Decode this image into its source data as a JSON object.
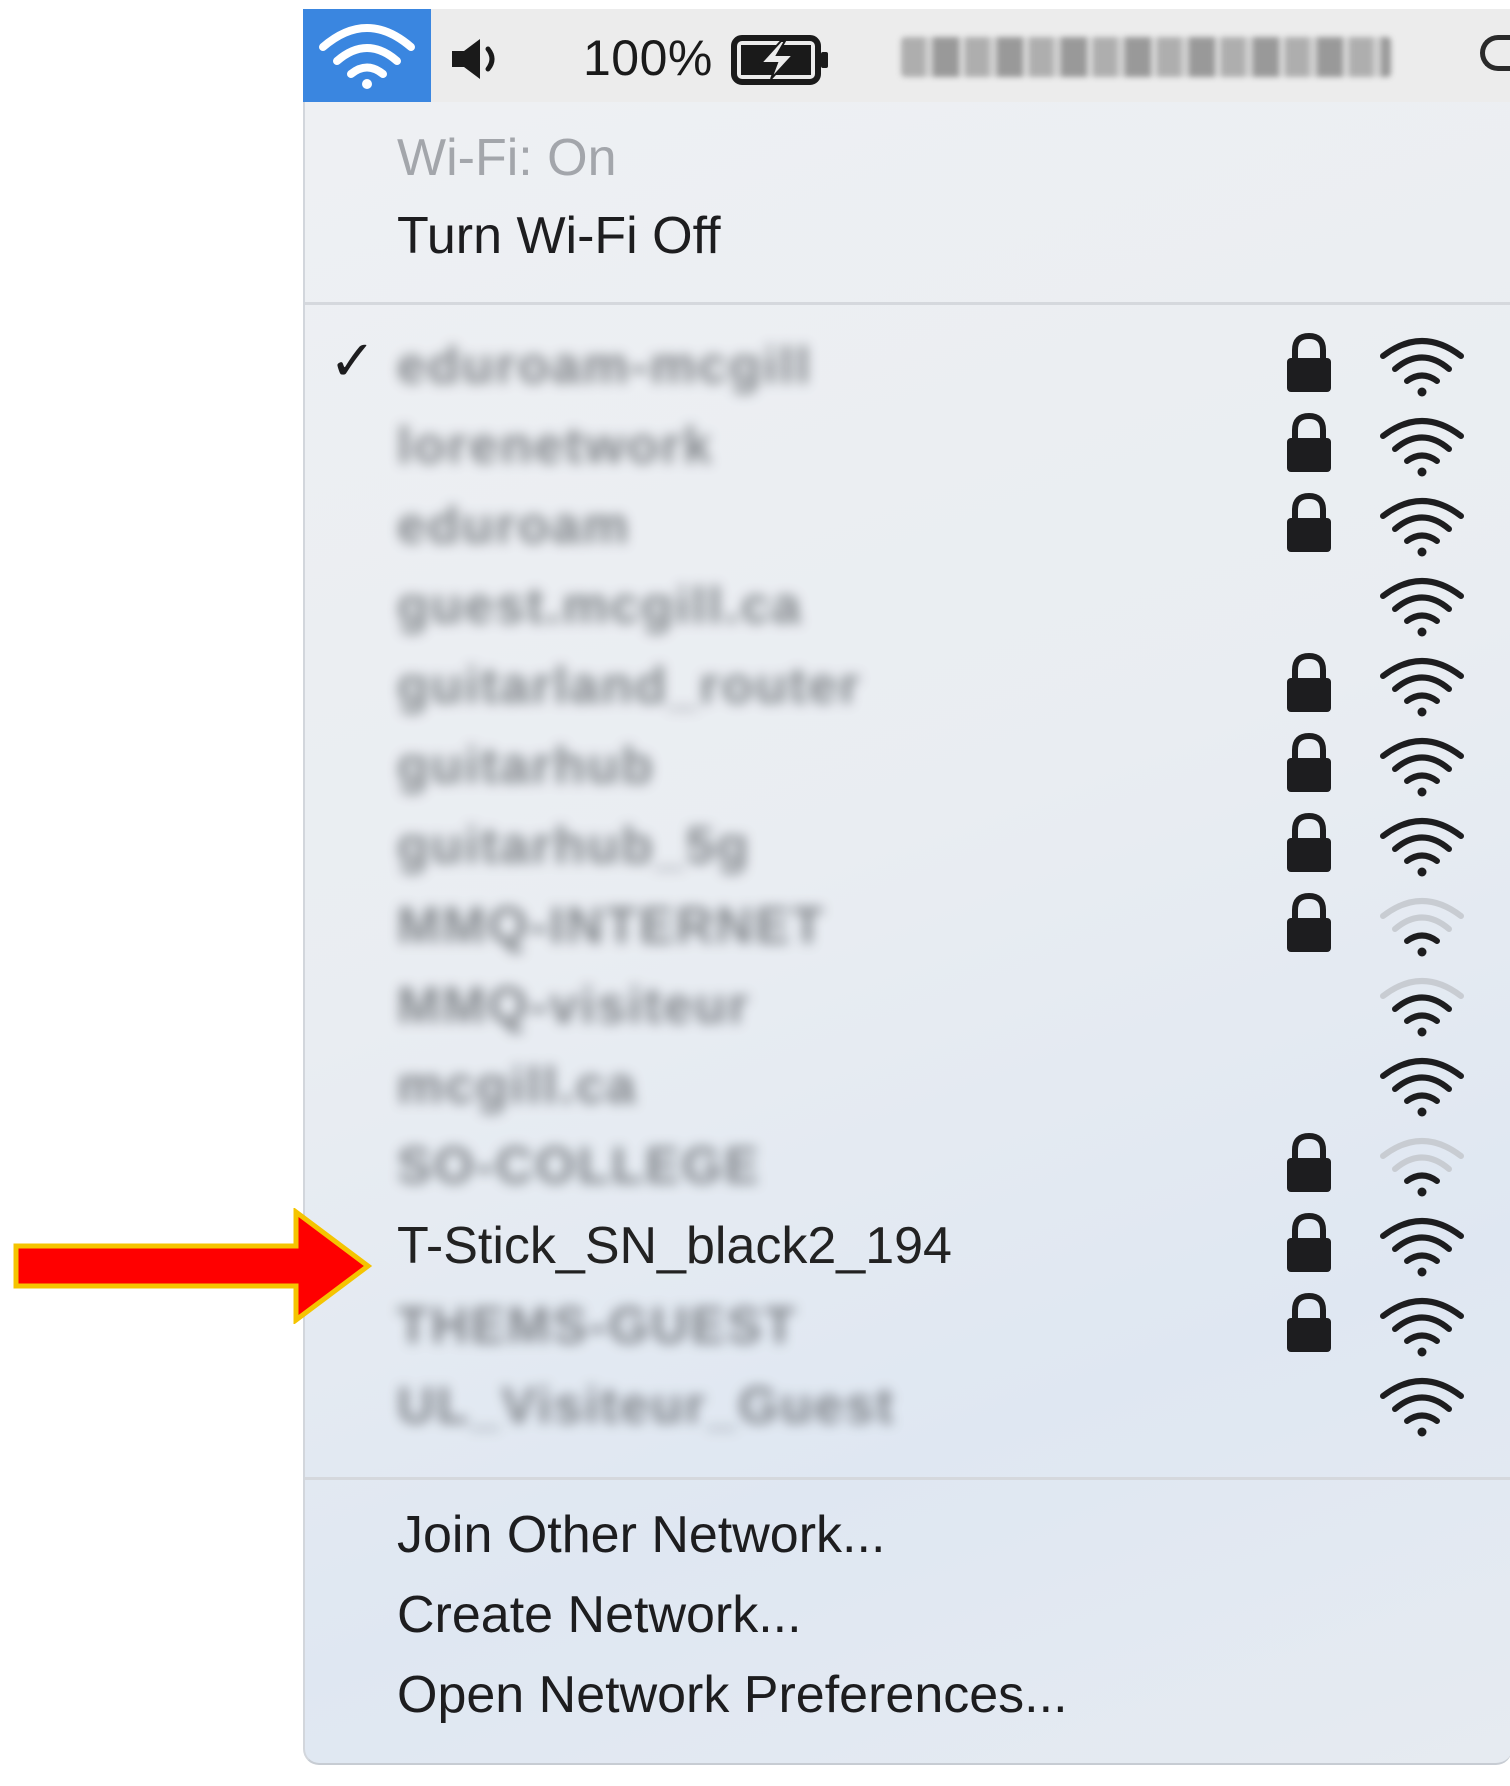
{
  "menubar": {
    "battery_percent": "100%",
    "wifi_icon": "wifi-icon",
    "volume_icon": "speaker-icon",
    "battery_icon": "battery-charging-icon",
    "search_icon": "spotlight-search-icon",
    "accent_color": "#3a86e0"
  },
  "wifi_menu": {
    "status": "Wi-Fi: On",
    "toggle": "Turn Wi-Fi Off",
    "networks": [
      {
        "name": "eduroam-mcgill",
        "connected": true,
        "locked": true,
        "signal": "full",
        "blurred": true
      },
      {
        "name": "lorenetwork",
        "connected": false,
        "locked": true,
        "signal": "full",
        "blurred": true
      },
      {
        "name": "eduroam",
        "connected": false,
        "locked": true,
        "signal": "full",
        "blurred": true
      },
      {
        "name": "guest.mcgill.ca",
        "connected": false,
        "locked": false,
        "signal": "full",
        "blurred": true
      },
      {
        "name": "guitarland_router",
        "connected": false,
        "locked": true,
        "signal": "full",
        "blurred": true
      },
      {
        "name": "guitarhub",
        "connected": false,
        "locked": true,
        "signal": "full",
        "blurred": true
      },
      {
        "name": "guitarhub_5g",
        "connected": false,
        "locked": true,
        "signal": "full",
        "blurred": true
      },
      {
        "name": "MMQ-INTERNET",
        "connected": false,
        "locked": true,
        "signal": "weak",
        "blurred": true
      },
      {
        "name": "MMQ-visiteur",
        "connected": false,
        "locked": false,
        "signal": "medium",
        "blurred": true
      },
      {
        "name": "mcgill.ca",
        "connected": false,
        "locked": false,
        "signal": "full",
        "blurred": true
      },
      {
        "name": "SO-COLLEGE",
        "connected": false,
        "locked": true,
        "signal": "weak",
        "blurred": true
      },
      {
        "name": "T-Stick_SN_black2_194",
        "connected": false,
        "locked": true,
        "signal": "full",
        "blurred": false
      },
      {
        "name": "THEMS-GUEST",
        "connected": false,
        "locked": true,
        "signal": "full",
        "blurred": true
      },
      {
        "name": "UL_Visiteur_Guest",
        "connected": false,
        "locked": false,
        "signal": "full",
        "blurred": true
      }
    ],
    "actions": {
      "join": "Join Other Network...",
      "create": "Create Network...",
      "prefs": "Open Network Preferences..."
    }
  },
  "annotation": {
    "arrow_color": "#ff0000",
    "arrow_outline_color": "#f5c400"
  }
}
